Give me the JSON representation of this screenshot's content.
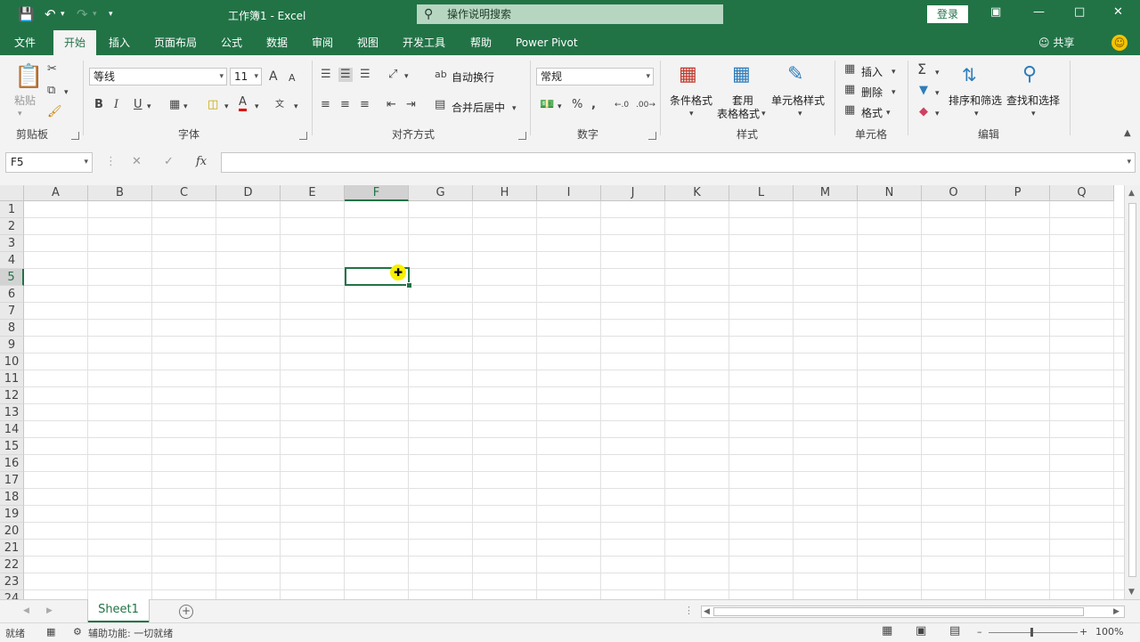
{
  "titlebar": {
    "title": "工作簿1  -  Excel",
    "search_placeholder": "操作说明搜索",
    "login": "登录"
  },
  "menu": {
    "tabs": [
      "文件",
      "开始",
      "插入",
      "页面布局",
      "公式",
      "数据",
      "审阅",
      "视图",
      "开发工具",
      "帮助",
      "Power Pivot"
    ],
    "active": "开始",
    "share": "共享"
  },
  "ribbon": {
    "clipboard": {
      "paste": "粘贴",
      "label": "剪贴板"
    },
    "font": {
      "name": "等线",
      "size": "11",
      "bold": "B",
      "italic": "I",
      "underline": "U",
      "grow": "A",
      "shrink": "A",
      "label": "字体"
    },
    "alignment": {
      "wrap": "自动换行",
      "merge": "合并后居中",
      "label": "对齐方式"
    },
    "number": {
      "format": "常规",
      "percent": "%",
      "comma": ",",
      "label": "数字"
    },
    "styles": {
      "conditional": "条件格式",
      "table_line1": "套用",
      "table_line2": "表格格式",
      "cell_styles": "单元格样式",
      "label": "样式"
    },
    "cells": {
      "insert": "插入",
      "delete": "删除",
      "format": "格式",
      "label": "单元格"
    },
    "editing": {
      "sort": "排序和筛选",
      "find": "查找和选择",
      "label": "编辑"
    }
  },
  "formula_bar": {
    "name_box": "F5",
    "fx": "fx",
    "value": ""
  },
  "grid": {
    "columns": [
      "A",
      "B",
      "C",
      "D",
      "E",
      "F",
      "G",
      "H",
      "I",
      "J",
      "K",
      "L",
      "M",
      "N",
      "O",
      "P",
      "Q"
    ],
    "rows": [
      "1",
      "2",
      "3",
      "4",
      "5",
      "6",
      "7",
      "8",
      "9",
      "10",
      "11",
      "12",
      "13",
      "14",
      "15",
      "16",
      "17",
      "18",
      "19",
      "20",
      "21",
      "22",
      "23",
      "24"
    ],
    "selected_column": "F",
    "selected_row": "5"
  },
  "sheets": {
    "tabs": [
      "Sheet1"
    ],
    "active": "Sheet1"
  },
  "status": {
    "ready": "就绪",
    "accessibility": "辅助功能: 一切就绪",
    "zoom": "100%"
  }
}
